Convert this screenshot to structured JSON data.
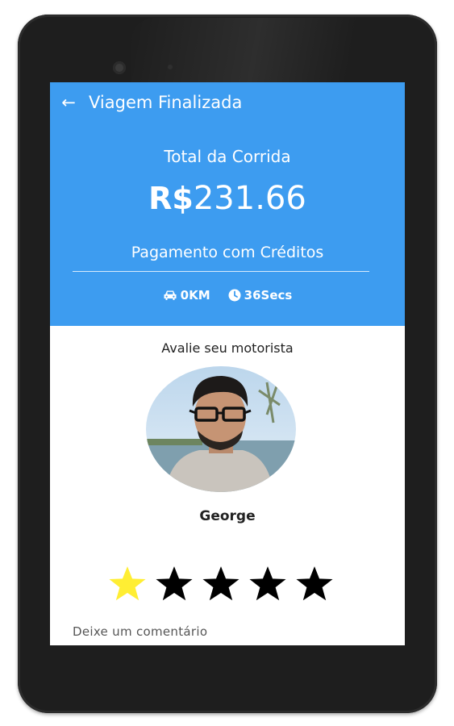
{
  "header": {
    "title": "Viagem Finalizada",
    "total_label": "Total da Corrida",
    "currency": "R$",
    "amount": "231.66",
    "payment_method": "Pagamento com Créditos",
    "distance": "0KM",
    "duration": "36Secs"
  },
  "rating": {
    "prompt": "Avalie seu motorista",
    "driver_name": "George",
    "stars_selected": 1,
    "stars_total": 5
  },
  "comment": {
    "placeholder": "Deixe um comentário",
    "value": ""
  },
  "icons": {
    "back": "arrow-left-icon",
    "distance": "car-icon",
    "duration": "clock-icon",
    "star": "star-icon"
  },
  "colors": {
    "header_bg": "#3d9cf0",
    "star_active": "#ffee33",
    "star_inactive": "#000000",
    "device_frame": "#1e1e1e"
  }
}
